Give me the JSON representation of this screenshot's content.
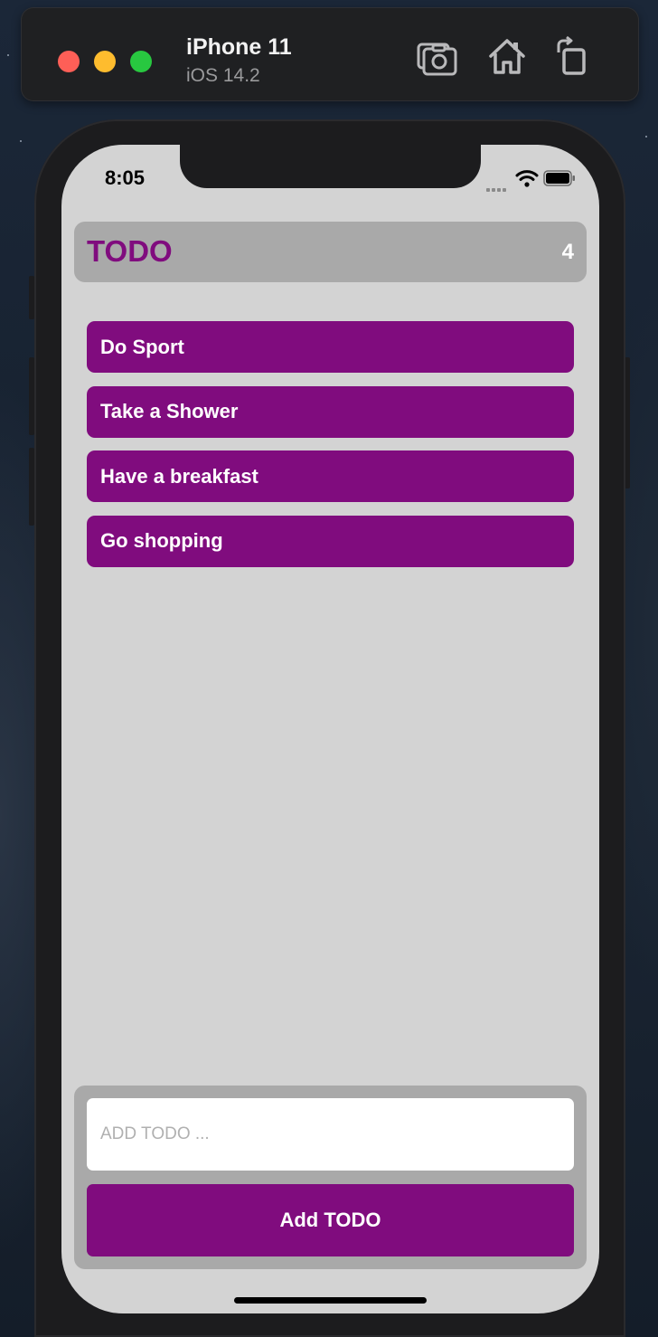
{
  "simulator": {
    "device_name": "iPhone 11",
    "os_version": "iOS 14.2",
    "toolbar_icons": [
      "screenshot-icon",
      "home-icon",
      "rotate-icon"
    ]
  },
  "status_bar": {
    "time": "8:05",
    "icons": [
      "cellular-signal-icon",
      "wifi-icon",
      "battery-icon"
    ]
  },
  "header": {
    "title": "TODO",
    "count": "4"
  },
  "todos": [
    {
      "label": "Do Sport"
    },
    {
      "label": "Take a Shower"
    },
    {
      "label": "Have a breakfast"
    },
    {
      "label": "Go shopping"
    }
  ],
  "form": {
    "input_placeholder": "ADD TODO ...",
    "input_value": "",
    "button_label": "Add TODO"
  },
  "colors": {
    "accent": "#800c7e",
    "panel": "#a9a9a9",
    "background": "#d3d3d3"
  }
}
